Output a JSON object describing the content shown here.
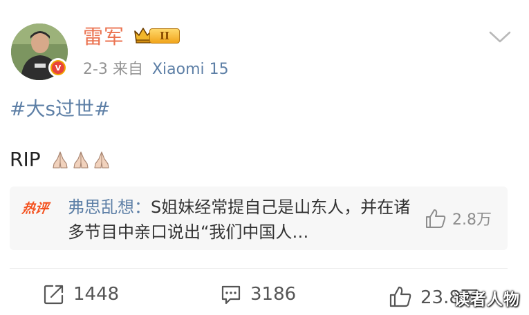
{
  "author": {
    "name": "雷军",
    "vip_level": "II"
  },
  "post_meta": {
    "date": "2-3",
    "source_prefix": "来自",
    "device": "Xiaomi 15"
  },
  "post": {
    "topic": "#大s过世#",
    "text": "RIP",
    "emoji": [
      "🙏🏻",
      "🙏🏻",
      "🙏🏻"
    ]
  },
  "hot_comment": {
    "badge": "热评",
    "user": "弗思乱想",
    "separator": "：",
    "text": "S姐妹经常提自己是山东人，并在诸多节目中亲口说出“我们中国人…",
    "like_count": "2.8万"
  },
  "actions": {
    "share_count": "1448",
    "comment_count": "3186",
    "like_count": "23.8万"
  },
  "watermark": "读者人物",
  "colors": {
    "name": "#eb7350",
    "link": "#5d7fa6",
    "hot_badge": "#f4511e",
    "meta": "#939393"
  },
  "icons": [
    "avatar",
    "verified-badge-icon",
    "vip-crown-icon",
    "chevron-down-icon",
    "thumbs-up-icon",
    "share-icon",
    "comment-icon"
  ]
}
